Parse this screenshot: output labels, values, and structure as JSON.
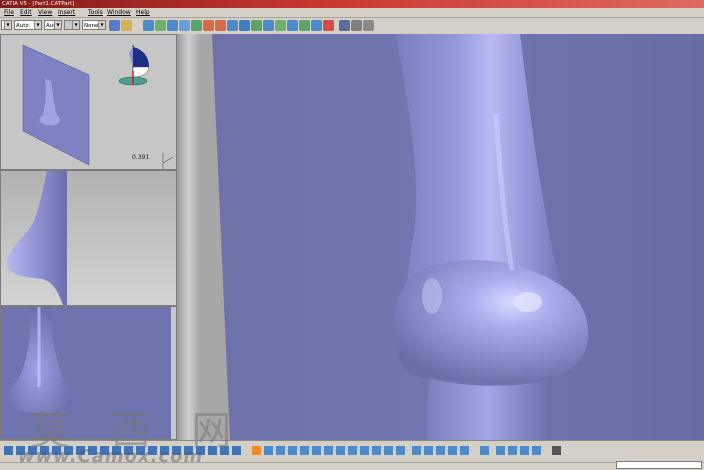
{
  "window": {
    "title": "CATIA V5 - [Part1.CATPart]"
  },
  "menu": [
    {
      "label": "File"
    },
    {
      "label": "Edit"
    },
    {
      "label": "View"
    },
    {
      "label": "Insert"
    },
    {
      "label": "Tools"
    },
    {
      "label": "Window"
    },
    {
      "label": "Help"
    }
  ],
  "toolbar": {
    "combo_1": "",
    "combo_2": "Auto",
    "combo_3": "Aut",
    "combo_4": "",
    "combo_5": "None"
  },
  "panes": {
    "top_value": "0.391"
  },
  "colors": {
    "model_surface": "#8c90d0",
    "viewport_bg": "#6f73ae",
    "ui_chrome": "#d4d0c8",
    "titlebar": "#c9362f"
  },
  "icons": {
    "compass": "compass-icon",
    "axis": "axis-icon"
  },
  "watermark": {
    "chinese": "莫 西 网",
    "url": "www.Camox.com"
  }
}
